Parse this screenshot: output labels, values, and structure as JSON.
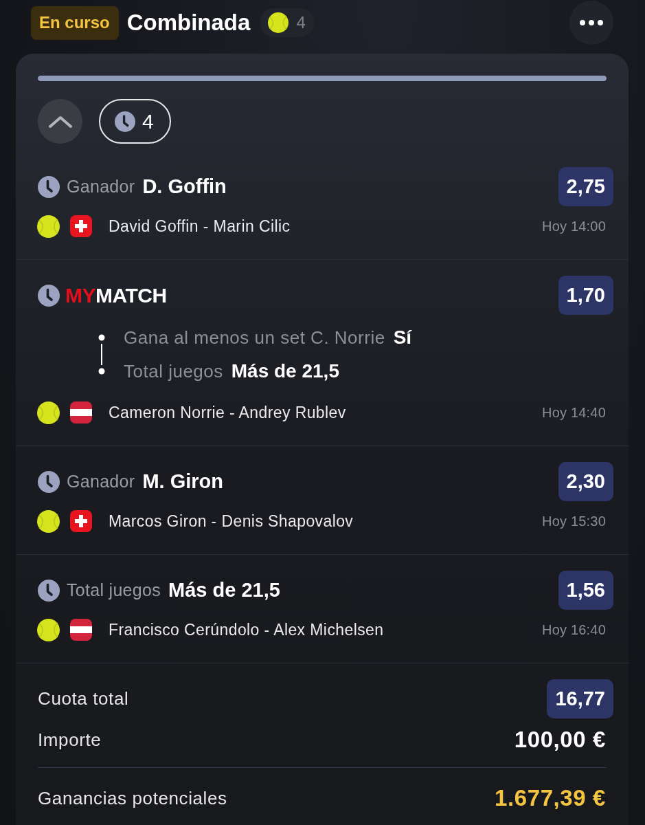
{
  "header": {
    "status": "En curso",
    "title": "Combinada",
    "sport_count": "4"
  },
  "progress": {
    "level": 1
  },
  "pending_count": "4",
  "selections": [
    {
      "kind": "single",
      "market": "Ganador",
      "pick": "D. Goffin",
      "odds": "2,75",
      "flag": {
        "kind": "switzerland"
      },
      "match": "David Goffin - Marin Cilic",
      "time": "Hoy 14:00"
    },
    {
      "kind": "mymatch",
      "logo": {
        "accent": "MY",
        "rest": "MATCH"
      },
      "odds": "1,70",
      "legs": [
        {
          "market": "Gana al menos un set C. Norrie",
          "pick": "Sí"
        },
        {
          "market": "Total juegos",
          "pick": "Más de 21,5"
        }
      ],
      "flag": {
        "kind": "austria"
      },
      "match": "Cameron Norrie - Andrey Rublev",
      "time": "Hoy 14:40"
    },
    {
      "kind": "single",
      "market": "Ganador",
      "pick": "M. Giron",
      "odds": "2,30",
      "flag": {
        "kind": "switzerland"
      },
      "match": "Marcos Giron - Denis Shapovalov",
      "time": "Hoy 15:30"
    },
    {
      "kind": "single",
      "market": "Total juegos",
      "pick": "Más de 21,5",
      "odds": "1,56",
      "flag": {
        "kind": "austria"
      },
      "match": "Francisco Cerúndolo - Alex Michelsen",
      "time": "Hoy 16:40"
    }
  ],
  "summary": {
    "total_odds_label": "Cuota total",
    "total_odds": "16,77",
    "stake_label": "Importe",
    "stake": "100,00 €",
    "payout_label": "Ganancias potenciales",
    "payout": "1.677,39 €"
  }
}
